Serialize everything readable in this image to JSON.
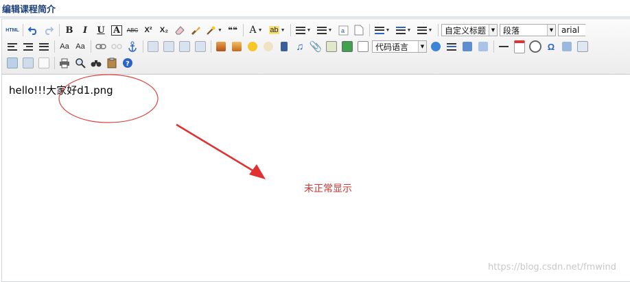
{
  "page": {
    "title": "编辑课程简介"
  },
  "toolbar": {
    "html_label": "HTML",
    "bold": "B",
    "italic": "I",
    "underline": "U",
    "border_text": "A",
    "strike": "ABC",
    "superscript": "X²",
    "subscript": "X₂",
    "quote": "❝❝",
    "font_color": "A",
    "highlight": "ab",
    "custom_title": "自定义标题",
    "paragraph": "段落",
    "font_family": "arial",
    "code_language": "代码语言",
    "omega": "Ω"
  },
  "editor": {
    "content_text": "hello!!!大家好d1.png"
  },
  "annotation": {
    "note": "未正常显示",
    "color": "#d6312e"
  },
  "watermark": "https://blog.csdn.net/fmwind"
}
